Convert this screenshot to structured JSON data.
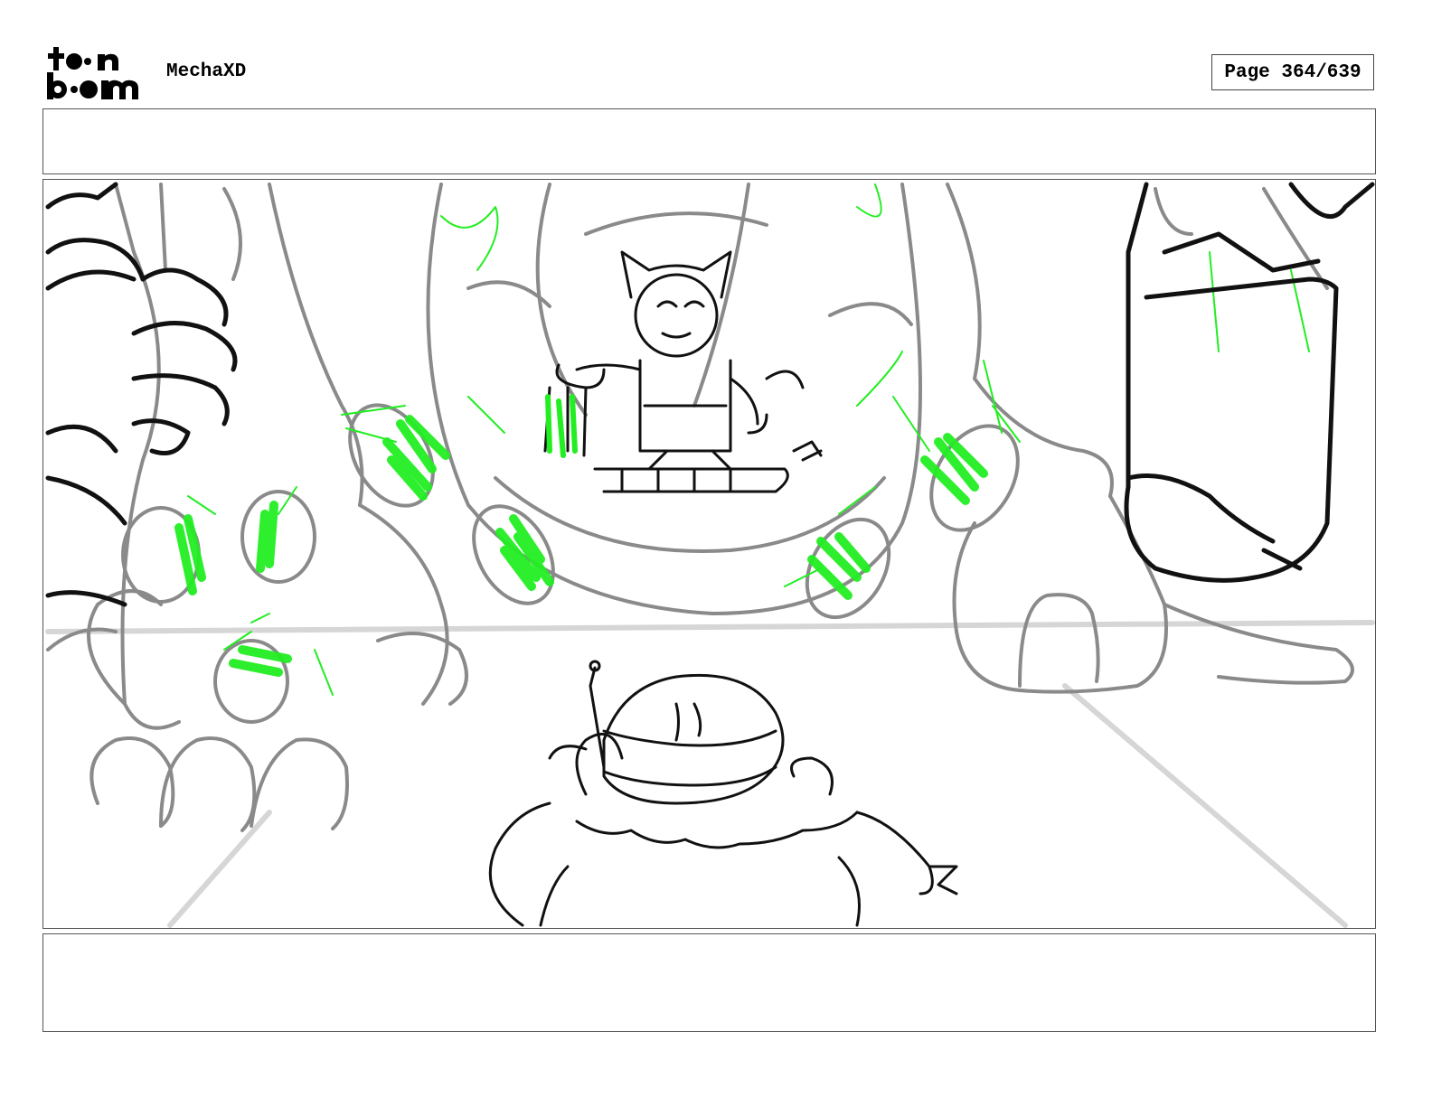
{
  "header": {
    "logo_text_line1": "toon",
    "logo_text_line2": "boom",
    "project_title": "MechaXD",
    "page_label": "Page 364/639"
  },
  "panel": {
    "dialogue": "",
    "action_notes": ""
  },
  "colors": {
    "sketch_gray": "#8a8a8a",
    "sketch_black": "#000000",
    "highlight_green": "#22ee22",
    "floor_gray": "#d0d0d0"
  }
}
